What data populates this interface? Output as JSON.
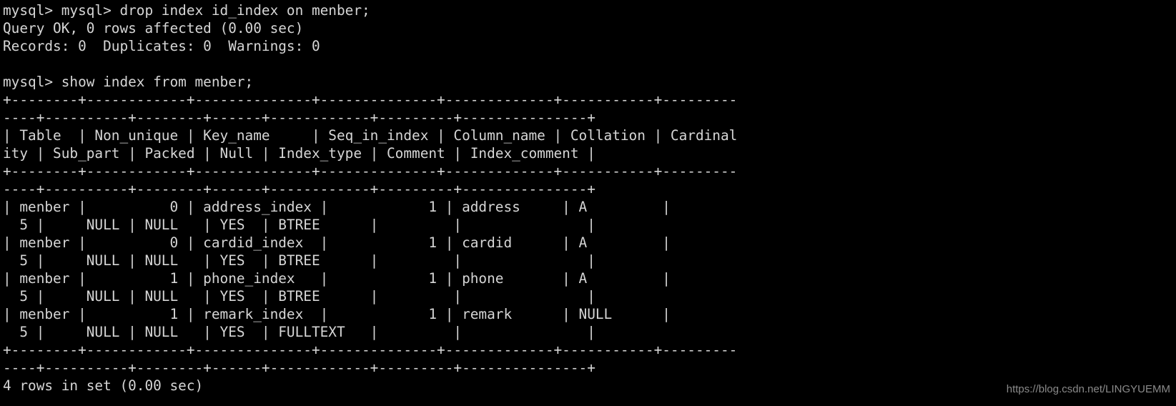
{
  "terminal": {
    "app": "mysql-client-terminal",
    "background_color": "#000000",
    "text_color": "#d6d6d6",
    "prompt": "mysql>",
    "columns": 98,
    "lines": [
      "mysql> mysql> drop index id_index on menber;",
      "Query OK, 0 rows affected (0.00 sec)",
      "Records: 0  Duplicates: 0  Warnings: 0",
      "",
      "mysql> show index from menber;",
      "+--------+------------+--------------+--------------+-------------+-----------+---------",
      "----+----------+--------+------+------------+---------+---------------+",
      "| Table  | Non_unique | Key_name     | Seq_in_index | Column_name | Collation | Cardinal",
      "ity | Sub_part | Packed | Null | Index_type | Comment | Index_comment |",
      "+--------+------------+--------------+--------------+-------------+-----------+---------",
      "----+----------+--------+------+------------+---------+---------------+",
      "| menber |          0 | address_index |            1 | address     | A         |",
      "  5 |     NULL | NULL   | YES  | BTREE      |         |               |",
      "| menber |          0 | cardid_index  |            1 | cardid      | A         |",
      "  5 |     NULL | NULL   | YES  | BTREE      |         |               |",
      "| menber |          1 | phone_index   |            1 | phone       | A         |",
      "  5 |     NULL | NULL   | YES  | BTREE      |         |               |",
      "| menber |          1 | remark_index  |            1 | remark      | NULL      |",
      "  5 |     NULL | NULL   | YES  | FULLTEXT   |         |               |",
      "+--------+------------+--------------+--------------+-------------+-----------+---------",
      "----+----------+--------+------+------------+---------+---------------+",
      "4 rows in set (0.00 sec)"
    ],
    "full_text": "mysql> mysql> drop index id_index on menber;\nQuery OK, 0 rows affected (0.00 sec)\nRecords: 0  Duplicates: 0  Warnings: 0\n\nmysql> show index from menber;\n+--------+------------+--------------+--------------+-------------+-----------+---------\n----+----------+--------+------+------------+---------+---------------+\n| Table  | Non_unique | Key_name     | Seq_in_index | Column_name | Collation | Cardinal\nity | Sub_part | Packed | Null | Index_type | Comment | Index_comment |\n+--------+------------+--------------+--------------+-------------+-----------+---------\n----+----------+--------+------+------------+---------+---------------+\n| menber |          0 | address_index |            1 | address     | A         |\n  5 |     NULL | NULL   | YES  | BTREE      |         |               |\n| menber |          0 | cardid_index  |            1 | cardid      | A         |\n  5 |     NULL | NULL   | YES  | BTREE      |         |               |\n| menber |          1 | phone_index   |            1 | phone       | A         |\n  5 |     NULL | NULL   | YES  | BTREE      |         |               |\n| menber |          1 | remark_index  |            1 | remark      | NULL      |\n  5 |     NULL | NULL   | YES  | FULLTEXT   |         |               |\n+--------+------------+--------------+--------------+-------------+-----------+---------\n----+----------+--------+------+------------+---------+---------------+\n4 rows in set (0.00 sec)"
  },
  "commands": [
    {
      "prompt_prefix": "mysql> mysql>",
      "sql": "drop index id_index on menber;",
      "result_status": "Query OK, 0 rows affected (0.00 sec)",
      "result_detail": "Records: 0  Duplicates: 0  Warnings: 0"
    },
    {
      "prompt_prefix": "mysql>",
      "sql": "show index from menber;",
      "result_status": "4 rows in set (0.00 sec)"
    }
  ],
  "result_table": {
    "columns": [
      "Table",
      "Non_unique",
      "Key_name",
      "Seq_in_index",
      "Column_name",
      "Collation",
      "Cardinality",
      "Sub_part",
      "Packed",
      "Null",
      "Index_type",
      "Comment",
      "Index_comment"
    ],
    "rows": [
      {
        "Table": "menber",
        "Non_unique": "0",
        "Key_name": "address_index",
        "Seq_in_index": "1",
        "Column_name": "address",
        "Collation": "A",
        "Cardinality": "5",
        "Sub_part": "NULL",
        "Packed": "NULL",
        "Null": "YES",
        "Index_type": "BTREE",
        "Comment": "",
        "Index_comment": ""
      },
      {
        "Table": "menber",
        "Non_unique": "0",
        "Key_name": "cardid_index",
        "Seq_in_index": "1",
        "Column_name": "cardid",
        "Collation": "A",
        "Cardinality": "5",
        "Sub_part": "NULL",
        "Packed": "NULL",
        "Null": "YES",
        "Index_type": "BTREE",
        "Comment": "",
        "Index_comment": ""
      },
      {
        "Table": "menber",
        "Non_unique": "1",
        "Key_name": "phone_index",
        "Seq_in_index": "1",
        "Column_name": "phone",
        "Collation": "A",
        "Cardinality": "5",
        "Sub_part": "NULL",
        "Packed": "NULL",
        "Null": "YES",
        "Index_type": "BTREE",
        "Comment": "",
        "Index_comment": ""
      },
      {
        "Table": "menber",
        "Non_unique": "1",
        "Key_name": "remark_index",
        "Seq_in_index": "1",
        "Column_name": "remark",
        "Collation": "NULL",
        "Cardinality": "5",
        "Sub_part": "NULL",
        "Packed": "NULL",
        "Null": "YES",
        "Index_type": "FULLTEXT",
        "Comment": "",
        "Index_comment": ""
      }
    ],
    "row_count": 4
  },
  "watermark": {
    "text": "https://blog.csdn.net/LINGYUEMM",
    "color": "#8a8a8a"
  }
}
